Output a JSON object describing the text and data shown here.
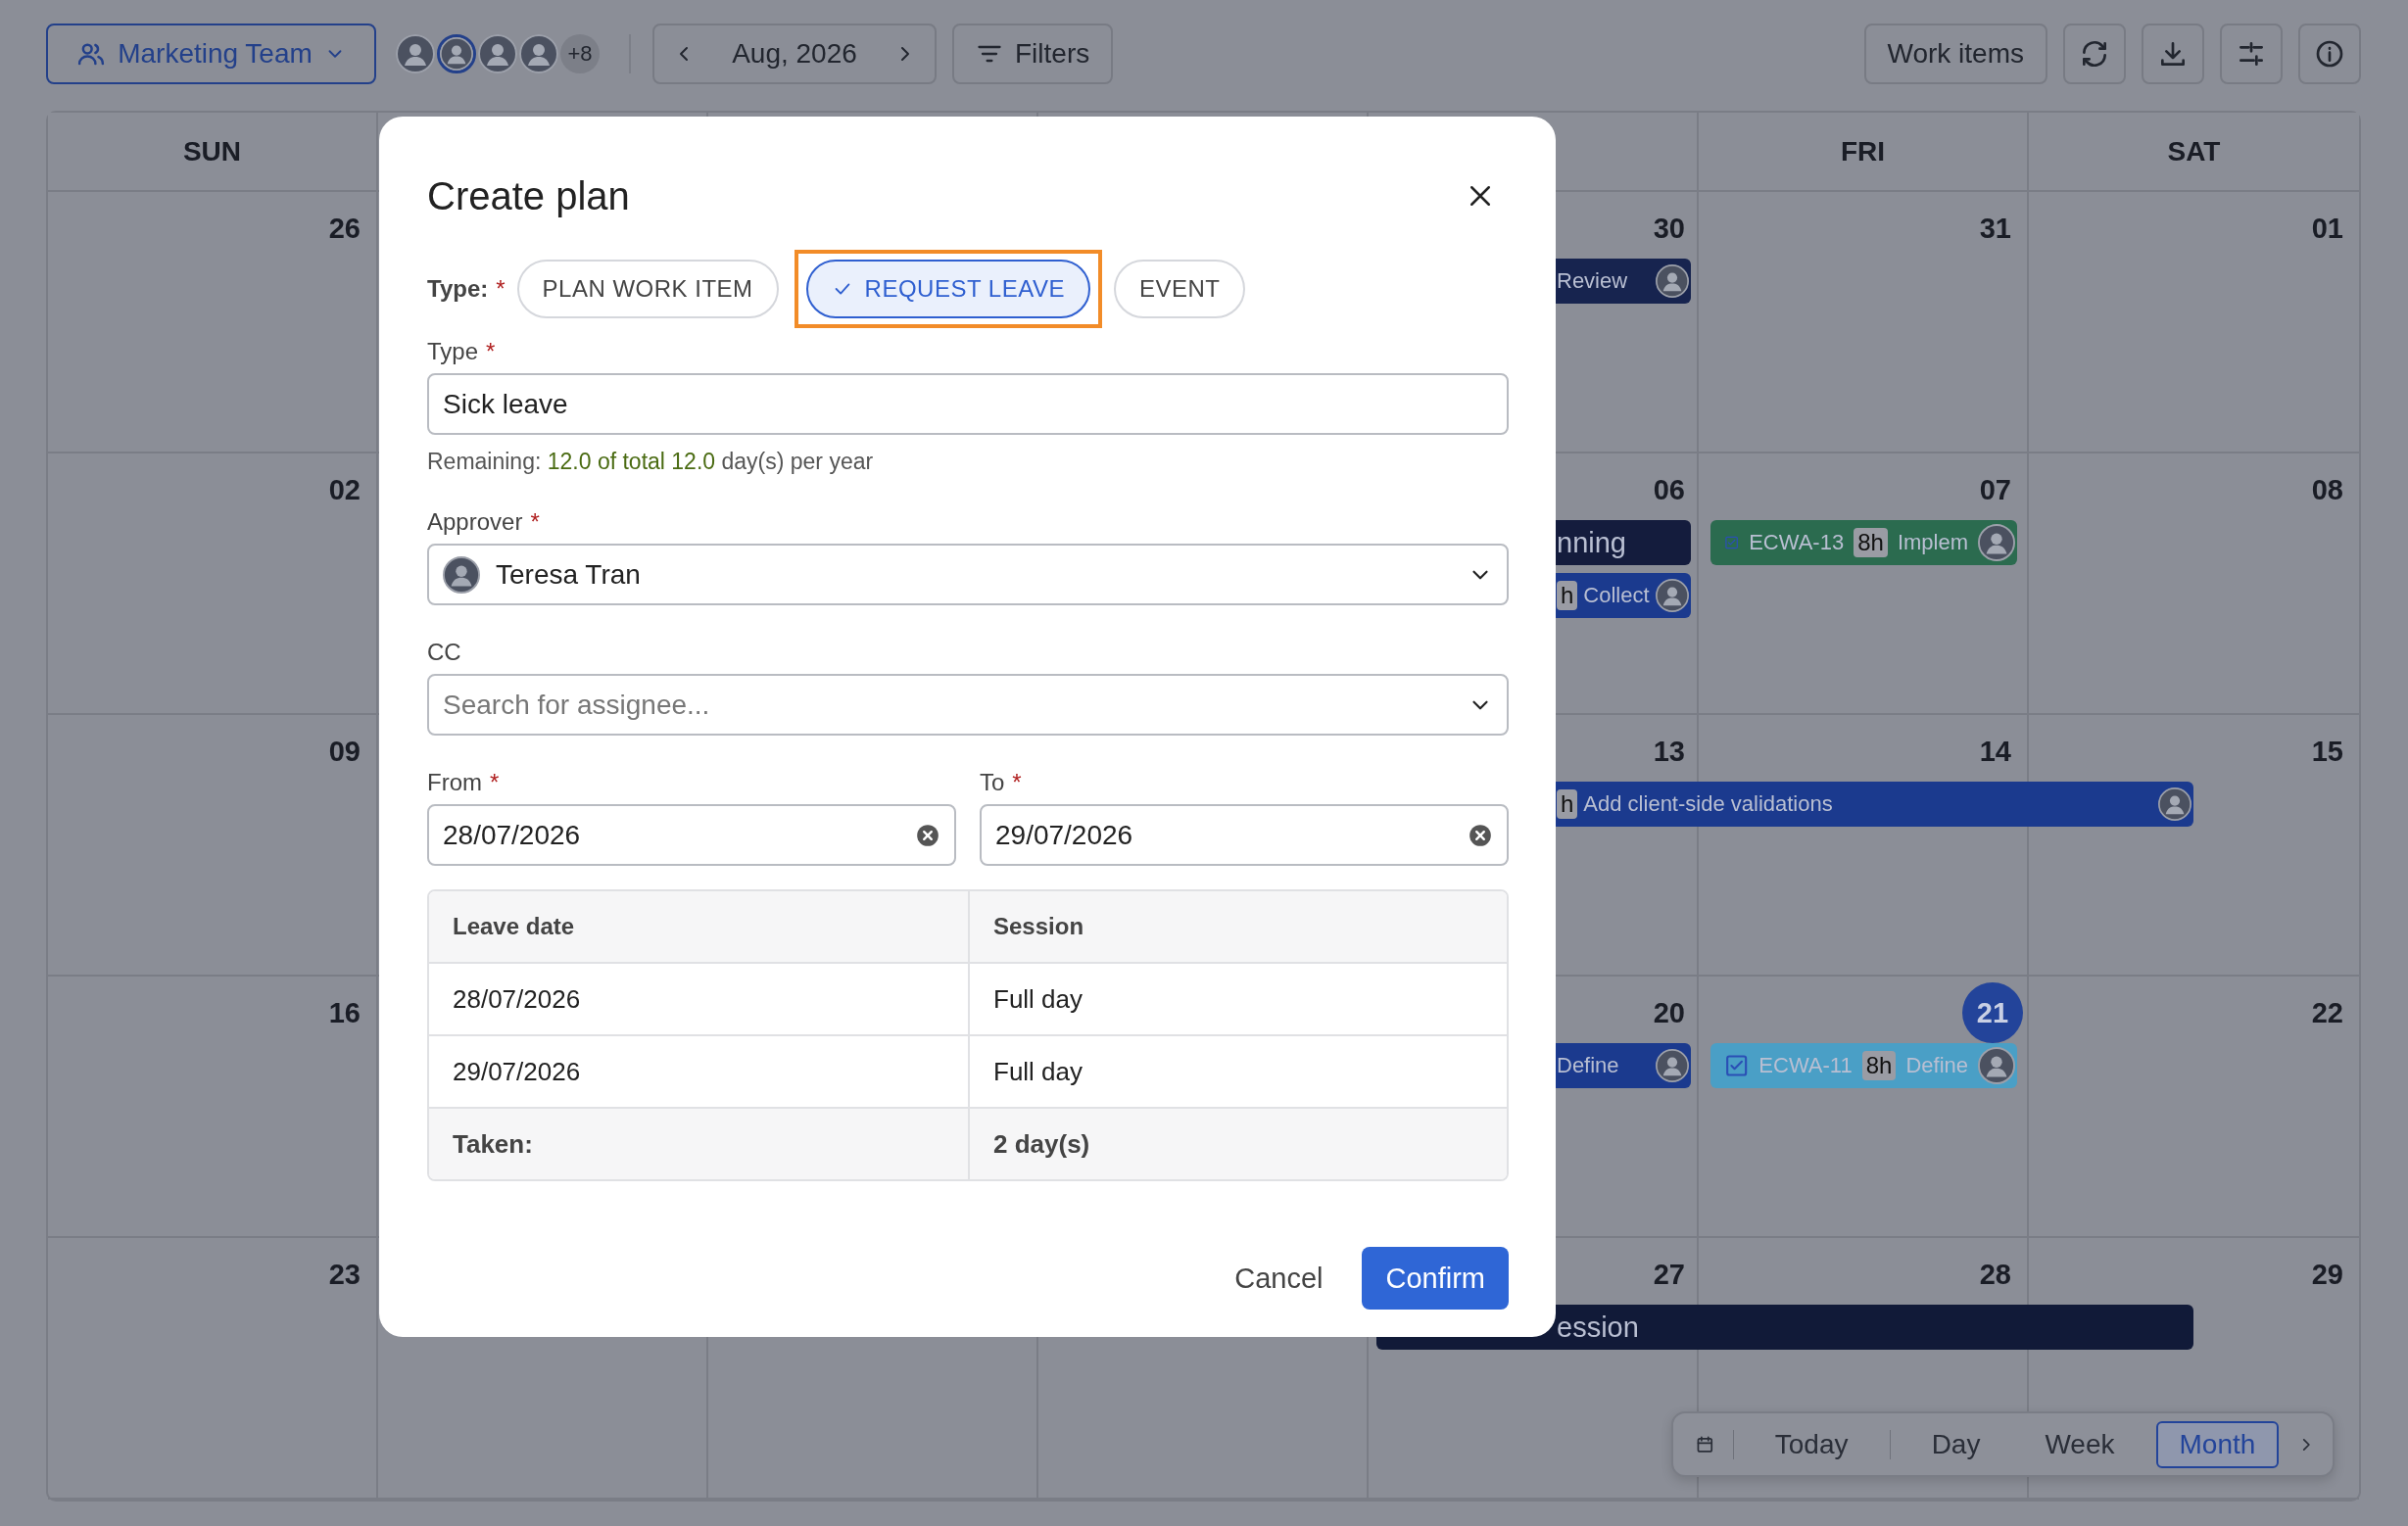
{
  "toolbar": {
    "team": "Marketing Team",
    "members": [
      {
        "selected": false
      },
      {
        "selected": true
      },
      {
        "selected": false
      },
      {
        "selected": false
      }
    ],
    "more_members": "+8",
    "month": "Aug, 2026",
    "filters": "Filters",
    "work_items": "Work items"
  },
  "calendar": {
    "weekdays": {
      "sun": "SUN",
      "fri": "FRI",
      "sat": "SAT"
    },
    "weeks": [
      {
        "sun": {
          "day": "26"
        },
        "thu": {
          "day": "30",
          "events": [
            {
              "kind": "plan",
              "color": "#17244f",
              "title": "Review"
            }
          ]
        },
        "fri": {
          "day": "31"
        },
        "sat": {
          "day": "01"
        }
      },
      {
        "sun": {
          "day": "02"
        },
        "thu": {
          "day": "06",
          "events": [
            {
              "kind": "session",
              "color": "#141c3d",
              "title": "nning"
            },
            {
              "kind": "plan",
              "color": "#1b3a8e",
              "hours": "h",
              "title": "Collect"
            }
          ]
        },
        "fri": {
          "day": "07",
          "events": [
            {
              "kind": "task",
              "color": "#2b6b4f",
              "code": "ECWA-13",
              "hours": "8h",
              "title": "Implem"
            }
          ]
        },
        "sat": {
          "day": "08"
        }
      },
      {
        "sun": {
          "day": "09"
        },
        "thu": {
          "day": "13",
          "events": [
            {
              "kind": "plan",
              "color": "#1b3a8e",
              "hours": "h",
              "title": "Add client-side validations",
              "multi_day": true
            }
          ]
        },
        "fri": {
          "day": "14"
        },
        "sat": {
          "day": "15"
        }
      },
      {
        "sun": {
          "day": "16"
        },
        "thu": {
          "day": "20",
          "events": [
            {
              "kind": "plan",
              "color": "#1b3a8e",
              "title": "Define"
            }
          ]
        },
        "fri": {
          "day": "21",
          "today": true,
          "events": [
            {
              "kind": "task",
              "color": "#4a9fc6",
              "code": "ECWA-11",
              "hours": "8h",
              "title": "Define"
            }
          ]
        },
        "sat": {
          "day": "22"
        }
      },
      {
        "sun": {
          "day": "23"
        },
        "thu": {
          "day": "27",
          "events": [
            {
              "kind": "session",
              "color": "#111a38",
              "title": "ession",
              "multi_day": true
            }
          ]
        },
        "fri": {
          "day": "28"
        },
        "sat": {
          "day": "29"
        }
      }
    ]
  },
  "view_bar": {
    "today": "Today",
    "views": [
      {
        "label": "Day",
        "selected": false
      },
      {
        "label": "Week",
        "selected": false
      },
      {
        "label": "Month",
        "selected": true
      }
    ]
  },
  "dialog": {
    "title": "Create plan",
    "required_mark": "*",
    "type_label": "Type:",
    "type_options": [
      {
        "label": "PLAN WORK ITEM",
        "selected": false,
        "highlighted": false
      },
      {
        "label": "REQUEST LEAVE",
        "selected": true,
        "highlighted": true
      },
      {
        "label": "EVENT",
        "selected": false,
        "highlighted": false
      }
    ],
    "leave_type": {
      "label": "Type",
      "required": true,
      "value": "Sick leave"
    },
    "remaining": {
      "prefix": "Remaining:",
      "amount": "12.0 of total 12.0",
      "suffix": "day(s) per year"
    },
    "approver": {
      "label": "Approver",
      "required": true,
      "value": "Teresa Tran"
    },
    "cc": {
      "label": "CC",
      "required": false,
      "placeholder": "Search for assignee..."
    },
    "from": {
      "label": "From",
      "required": true,
      "value": "28/07/2026"
    },
    "to": {
      "label": "To",
      "required": true,
      "value": "29/07/2026"
    },
    "leave_table": {
      "columns": [
        "Leave date",
        "Session"
      ],
      "rows": [
        [
          "28/07/2026",
          "Full day"
        ],
        [
          "29/07/2026",
          "Full day"
        ]
      ],
      "total": [
        "Taken:",
        "2 day(s)"
      ]
    },
    "cancel": "Cancel",
    "confirm": "Confirm"
  }
}
